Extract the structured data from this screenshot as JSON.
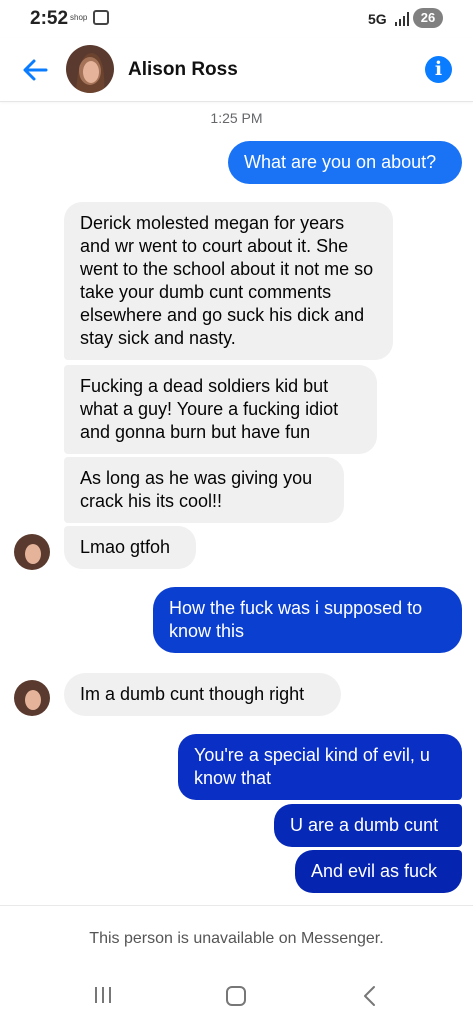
{
  "status_bar": {
    "time": "2:52",
    "carrier_label": "shop",
    "network": "5G",
    "battery": "26"
  },
  "header": {
    "contact_name": "Alison Ross"
  },
  "conversation": {
    "timestamp": "1:25 PM",
    "messages": [
      {
        "side": "out",
        "text": "What are you on about?"
      },
      {
        "side": "in",
        "text": "Derick molested megan for years and wr went to court about it. She went to the school about it not me so take your dumb cunt comments elsewhere and go suck his dick and stay sick and nasty."
      },
      {
        "side": "in",
        "text": "Fucking a dead soldiers kid but what a guy! Youre a fucking idiot and gonna burn but have fun"
      },
      {
        "side": "in",
        "text": "As long as he was giving you crack his its cool!!"
      },
      {
        "side": "in",
        "text": "Lmao gtfoh"
      },
      {
        "side": "out",
        "text": "How the fuck was i supposed to know this"
      },
      {
        "side": "in",
        "text": "Im a dumb cunt though right"
      },
      {
        "side": "out",
        "text": "You're a special kind of evil, u know that"
      },
      {
        "side": "out",
        "text": "U are a dumb cunt"
      },
      {
        "side": "out",
        "text": "And evil as fuck"
      }
    ]
  },
  "footer": {
    "notice": "This person is unavailable on Messenger."
  },
  "colors": {
    "accent": "#0a7cff",
    "incoming_bubble": "#f0f0f0",
    "outgoing_gradient_top": "#1877f2",
    "outgoing_gradient_bottom": "#0025b8"
  }
}
